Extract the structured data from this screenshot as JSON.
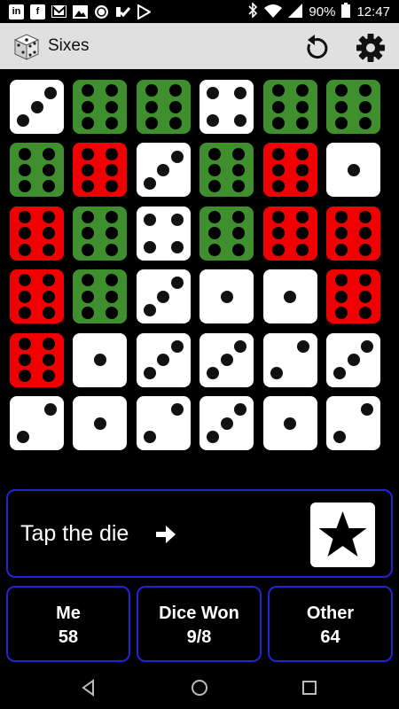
{
  "status_bar": {
    "battery": "90%",
    "time": "12:47",
    "notification_icons": [
      "linkedin-icon",
      "facebook-icon",
      "gmail-icon",
      "image-icon",
      "sync-icon",
      "checkmark-icon",
      "play-store-icon"
    ]
  },
  "app": {
    "title": "Sixes"
  },
  "colors": {
    "white_die": "#ffffff",
    "green_die": "#3f8f2e",
    "red_die": "#f00000",
    "panel_border": "#2224d8",
    "app_bar": "#e0e0e0"
  },
  "dice": [
    [
      {
        "value": 3,
        "color": "white"
      },
      {
        "value": 6,
        "color": "green"
      },
      {
        "value": 6,
        "color": "green"
      },
      {
        "value": 4,
        "color": "white"
      },
      {
        "value": 6,
        "color": "green"
      },
      {
        "value": 6,
        "color": "green"
      }
    ],
    [
      {
        "value": 6,
        "color": "green"
      },
      {
        "value": 6,
        "color": "red"
      },
      {
        "value": 3,
        "color": "white"
      },
      {
        "value": 6,
        "color": "green"
      },
      {
        "value": 6,
        "color": "red"
      },
      {
        "value": 1,
        "color": "white"
      }
    ],
    [
      {
        "value": 6,
        "color": "red"
      },
      {
        "value": 6,
        "color": "green"
      },
      {
        "value": 4,
        "color": "white"
      },
      {
        "value": 6,
        "color": "green"
      },
      {
        "value": 6,
        "color": "red"
      },
      {
        "value": 6,
        "color": "red"
      }
    ],
    [
      {
        "value": 6,
        "color": "red"
      },
      {
        "value": 6,
        "color": "green"
      },
      {
        "value": 3,
        "color": "white"
      },
      {
        "value": 1,
        "color": "white"
      },
      {
        "value": 1,
        "color": "white"
      },
      {
        "value": 6,
        "color": "red"
      }
    ],
    [
      {
        "value": 6,
        "color": "red"
      },
      {
        "value": 1,
        "color": "white"
      },
      {
        "value": 3,
        "color": "white"
      },
      {
        "value": 3,
        "color": "white"
      },
      {
        "value": 2,
        "color": "white"
      },
      {
        "value": 3,
        "color": "white"
      }
    ],
    [
      {
        "value": 2,
        "color": "white"
      },
      {
        "value": 1,
        "color": "white"
      },
      {
        "value": 2,
        "color": "white"
      },
      {
        "value": 3,
        "color": "white"
      },
      {
        "value": 1,
        "color": "white"
      },
      {
        "value": 2,
        "color": "white"
      }
    ]
  ],
  "prompt": {
    "text": "Tap the die",
    "arrow_icon": "arrow-right-icon",
    "button_icon": "star-icon"
  },
  "scores": {
    "me_label": "Me",
    "me_value": "58",
    "dice_won_label": "Dice Won",
    "dice_won_value": "9/8",
    "other_label": "Other",
    "other_value": "64"
  },
  "nav": {
    "icons": [
      "back-icon",
      "home-icon",
      "recents-icon"
    ]
  }
}
